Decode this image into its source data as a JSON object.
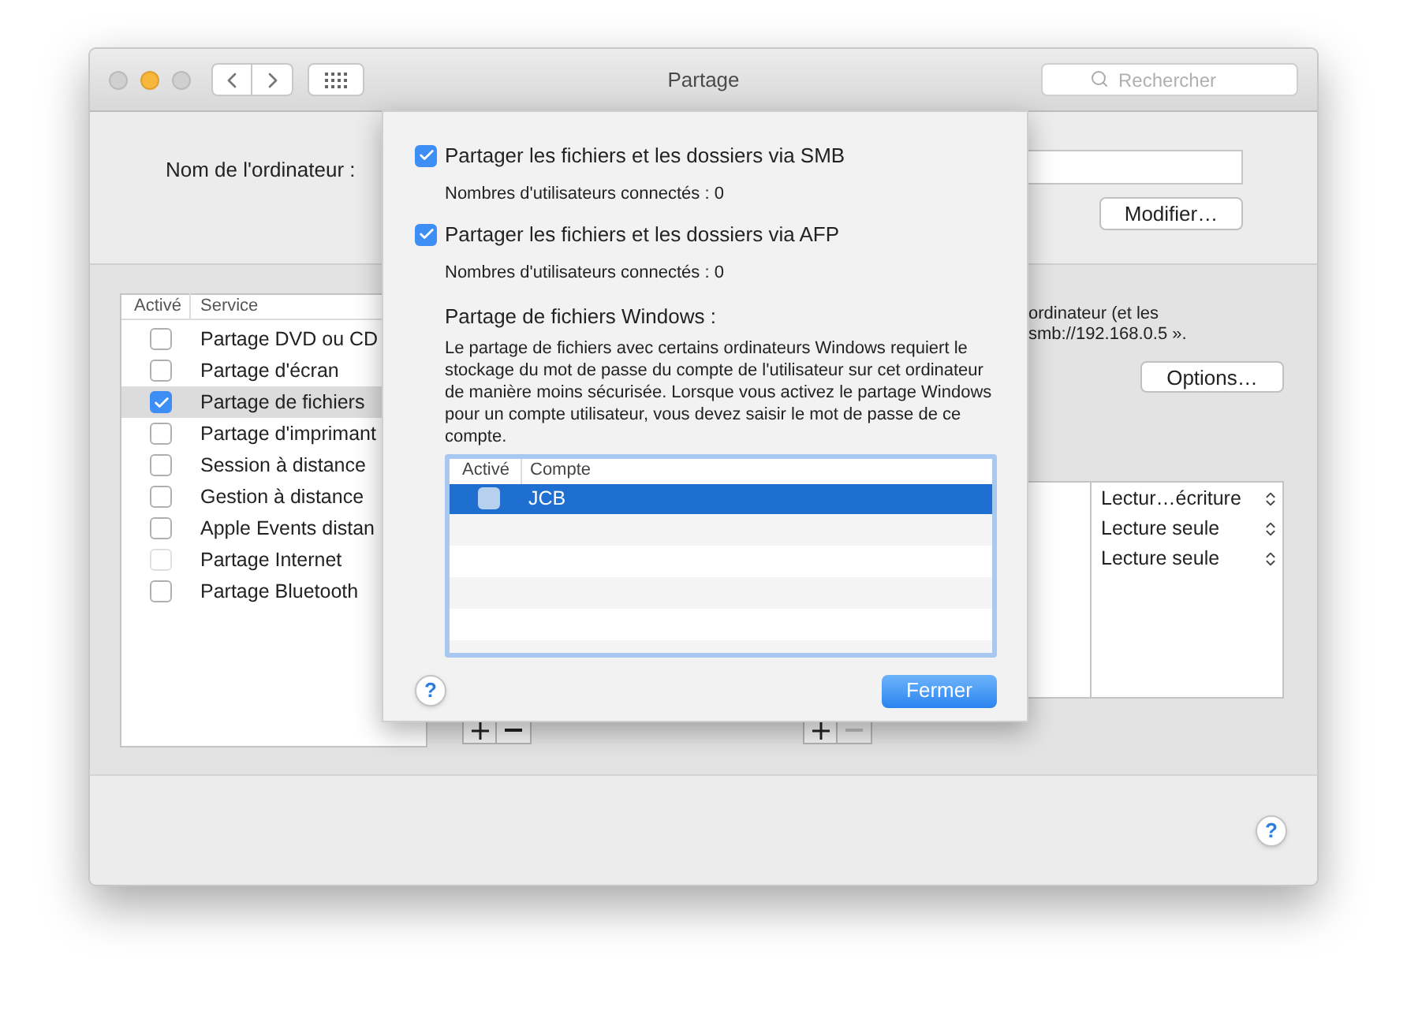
{
  "window": {
    "title": "Partage",
    "search": {
      "placeholder": "Rechercher"
    }
  },
  "computer_name": {
    "label": "Nom de l'ordinateur :",
    "button": "Modifier…"
  },
  "services": {
    "columns": [
      "Activé",
      "Service"
    ],
    "items": [
      {
        "name": "Partage DVD ou CD",
        "checked": false,
        "selected": false,
        "disabled": false
      },
      {
        "name": "Partage d'écran",
        "checked": false,
        "selected": false,
        "disabled": false
      },
      {
        "name": "Partage de fichiers",
        "checked": true,
        "selected": true,
        "disabled": false
      },
      {
        "name": "Partage d'imprimant",
        "checked": false,
        "selected": false,
        "disabled": false
      },
      {
        "name": "Session à distance",
        "checked": false,
        "selected": false,
        "disabled": false
      },
      {
        "name": "Gestion à distance",
        "checked": false,
        "selected": false,
        "disabled": false
      },
      {
        "name": "Apple Events distan",
        "checked": false,
        "selected": false,
        "disabled": false
      },
      {
        "name": "Partage Internet",
        "checked": false,
        "selected": false,
        "disabled": true
      },
      {
        "name": "Partage Bluetooth",
        "checked": false,
        "selected": false,
        "disabled": false
      }
    ]
  },
  "description": [
    "ordinateur (et les",
    "smb://192.168.0.5 »."
  ],
  "options_button": "Options…",
  "permissions": [
    "Lectur…écriture",
    "Lecture seule",
    "Lecture seule"
  ],
  "users_buttons": {
    "remove_disabled": true
  },
  "help": "?",
  "sheet": {
    "options": [
      {
        "label": "Partager les fichiers et les dossiers via SMB",
        "checked": true,
        "status": "Nombres d'utilisateurs connectés : 0"
      },
      {
        "label": "Partager les fichiers et les dossiers via AFP",
        "checked": true,
        "status": "Nombres d'utilisateurs connectés : 0"
      }
    ],
    "windows_heading": "Partage de fichiers Windows :",
    "windows_text": "Le partage de fichiers avec certains ordinateurs Windows requiert le stockage du mot de passe du compte de l'utilisateur sur cet ordinateur de manière moins sécurisée. Lorsque vous activez le partage Windows pour un compte utilisateur, vous devez saisir le mot de passe de ce compte.",
    "accounts": {
      "columns": [
        "Activé",
        "Compte"
      ],
      "rows": [
        {
          "name": "JCB",
          "checked": false,
          "selected": true
        }
      ]
    },
    "help": "?",
    "close_button": "Fermer"
  }
}
